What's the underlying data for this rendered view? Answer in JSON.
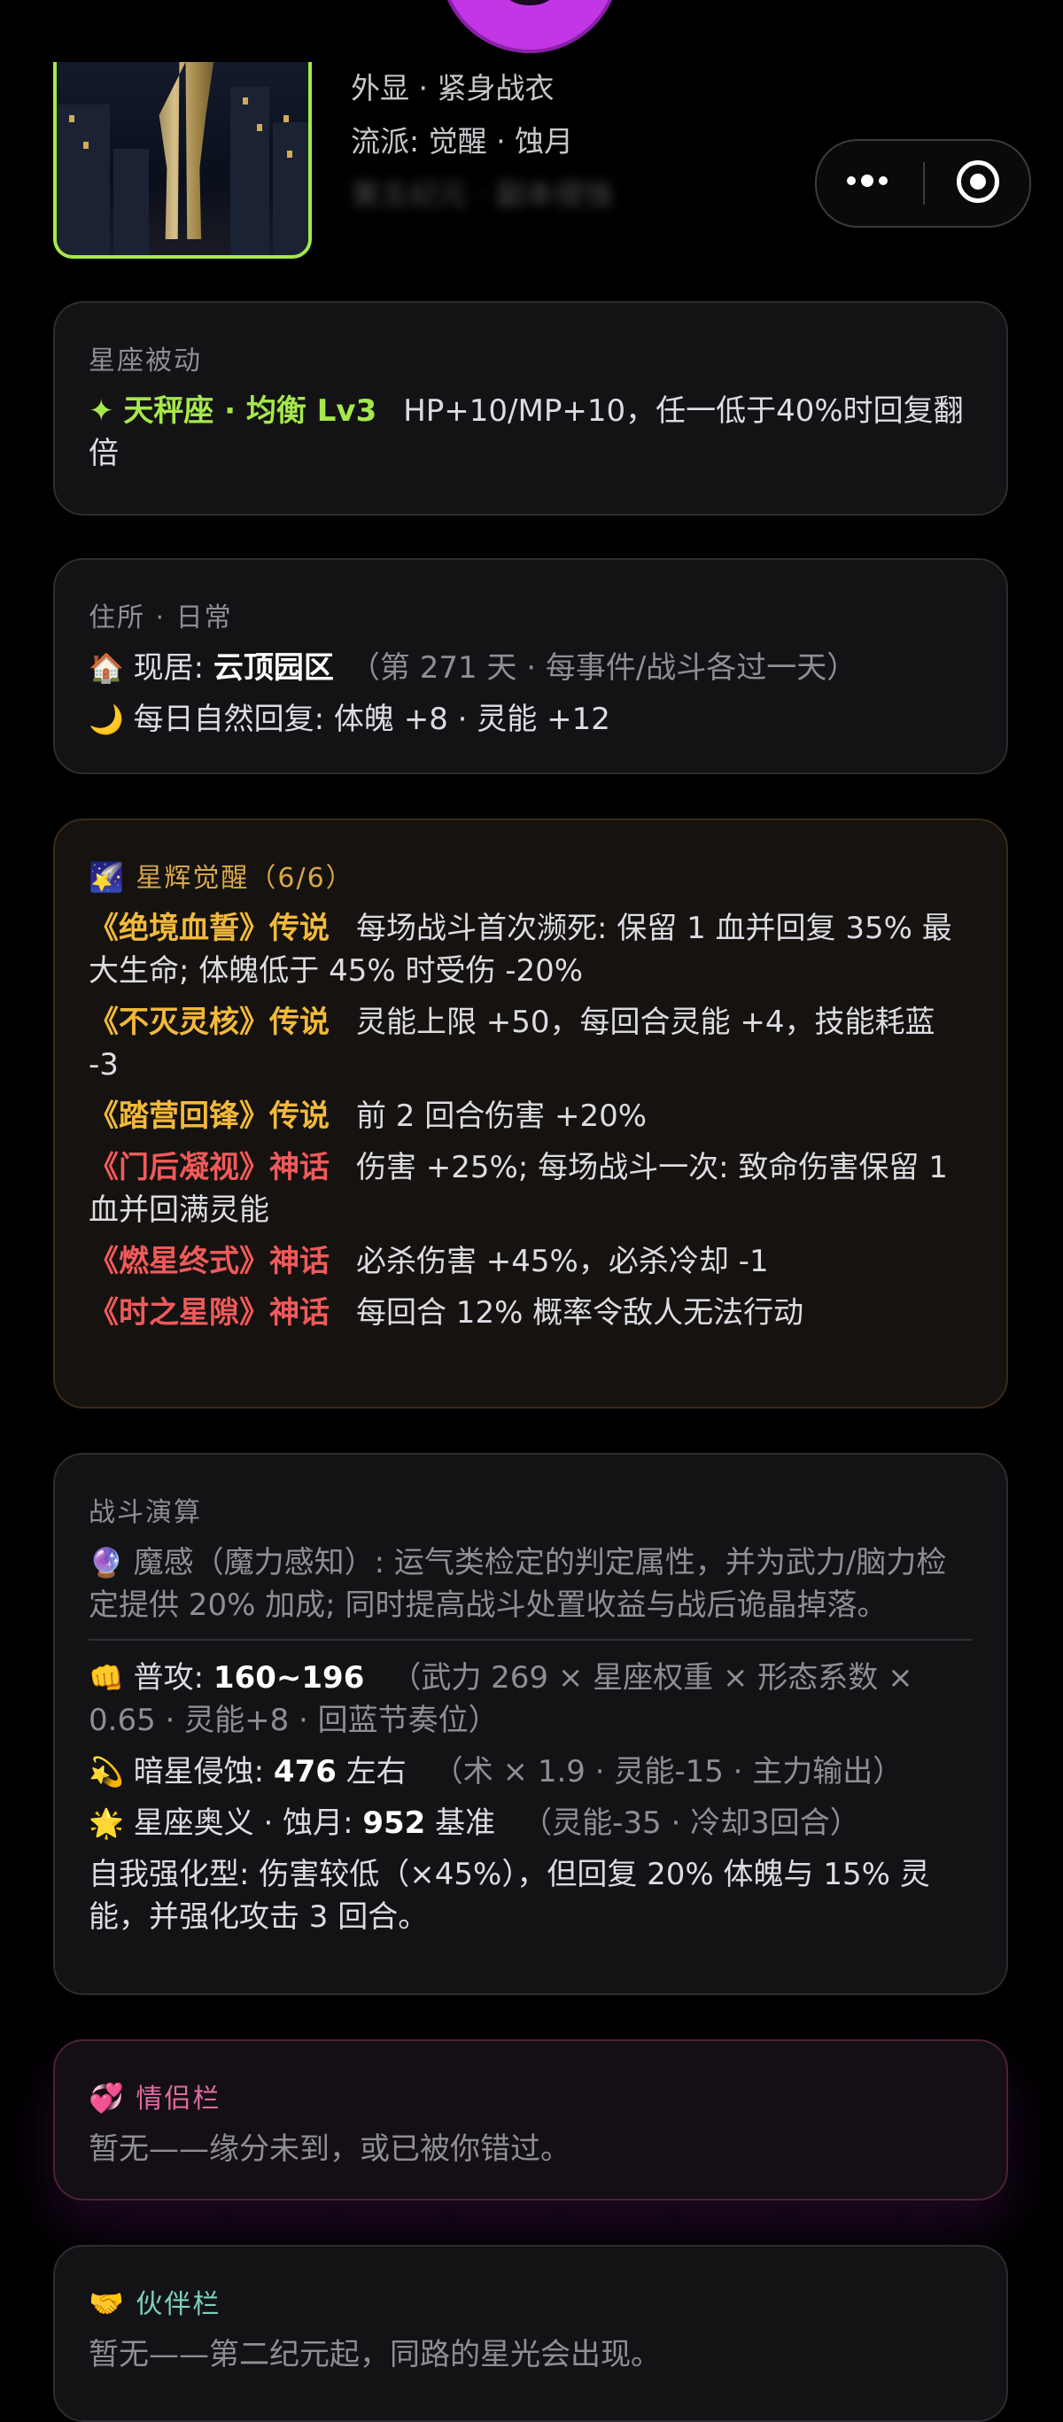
{
  "profile": {
    "appearance": "外显 · 紧身战衣",
    "school": "流派: 觉醒 · 蚀月",
    "era": "第五纪元 · 副本侵蚀"
  },
  "constellation": {
    "title": "星座被动",
    "star_icon": "✦",
    "name": "天秤座 · 均衡 Lv3",
    "desc": "HP+10/MP+10，任一低于40%时回复翻倍"
  },
  "residence": {
    "title": "住所 · 日常",
    "house_icon": "🏠",
    "current_label": "现居: ",
    "current_value": "云顶园区",
    "days": "（第 271 天 · 每事件/战斗各过一天）",
    "moon_icon": "🌙",
    "daily": "每日自然回复: 体魄 +8 · 灵能 +12"
  },
  "awakening": {
    "icon": "🌠",
    "title": "星辉觉醒（6/6）",
    "items": [
      {
        "name": "《绝境血誓》传说",
        "desc": "每场战斗首次濒死: 保留 1 血并回复 35% 最大生命; 体魄低于 45% 时受伤 -20%",
        "tier": "legend"
      },
      {
        "name": "《不灭灵核》传说",
        "desc": "灵能上限 +50，每回合灵能 +4，技能耗蓝 -3",
        "tier": "legend"
      },
      {
        "name": "《踏营回锋》传说",
        "desc": "前 2 回合伤害 +20%",
        "tier": "legend"
      },
      {
        "name": "《门后凝视》神话",
        "desc": "伤害 +25%; 每场战斗一次: 致命伤害保留 1 血并回满灵能",
        "tier": "myth"
      },
      {
        "name": "《燃星终式》神话",
        "desc": "必杀伤害 +45%，必杀冷却 -1",
        "tier": "myth"
      },
      {
        "name": "《时之星隙》神话",
        "desc": "每回合 12% 概率令敌人无法行动",
        "tier": "myth"
      }
    ]
  },
  "battle": {
    "title": "战斗演算",
    "crystal_icon": "🔮",
    "note": "魔感（魔力感知）: 运气类检定的判定属性，并为武力/脑力检定提供 20% 加成; 同时提高战斗处置收益与战后诡晶掉落。",
    "normal": {
      "icon": "👊",
      "label": "普攻: ",
      "value": "160~196",
      "detail": "（武力 269 × 星座权重 × 形态系数 × 0.65 · 灵能+8 · 回蓝节奏位）"
    },
    "dark": {
      "icon": "💫",
      "label": "暗星侵蚀: ",
      "value": "476",
      "suffix": " 左右",
      "detail": "（术 × 1.9 · 灵能-15 · 主力输出）"
    },
    "ultimate": {
      "icon": "🌟",
      "label": "星座奥义 · 蚀月: ",
      "value": "952",
      "suffix": " 基准",
      "detail": "（灵能-35 · 冷却3回合）"
    },
    "summary": "自我强化型: 伤害较低（×45%），但回复 20% 体魄与 15% 灵能，并强化攻击 3 回合。"
  },
  "lover": {
    "icon": "💞",
    "title": "情侣栏",
    "text": "暂无——缘分未到，或已被你错过。"
  },
  "partner": {
    "icon": "🤝",
    "title": "伙伴栏",
    "text": "暂无——第二纪元起，同路的星光会出现。"
  }
}
